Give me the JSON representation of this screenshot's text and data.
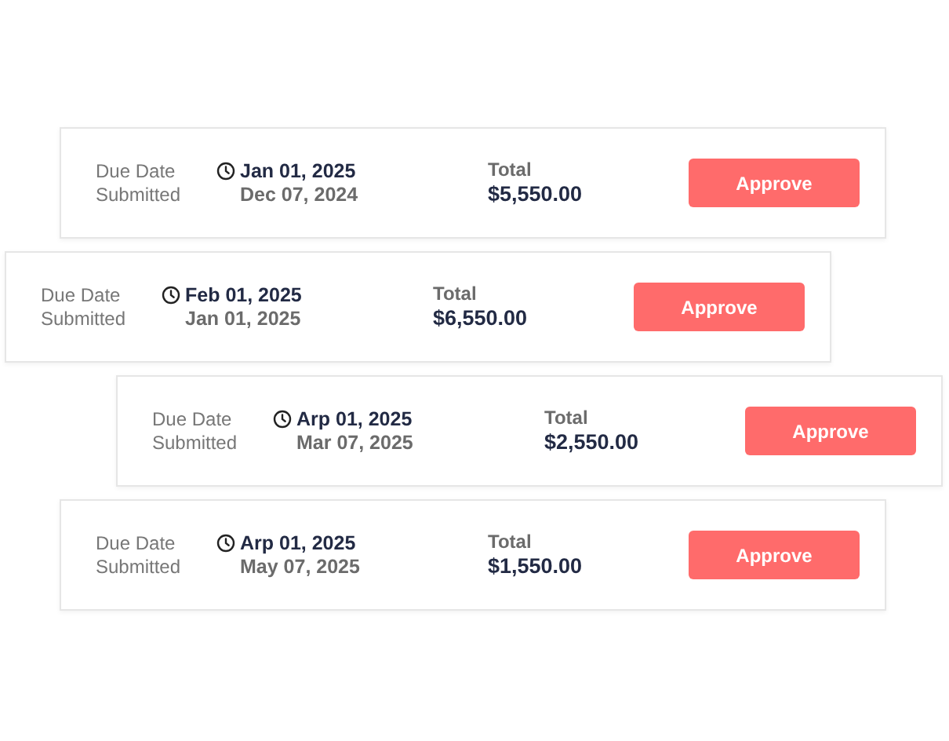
{
  "invoices": [
    {
      "due_label": "Due Date",
      "submitted_label": "Submitted",
      "due_date": "Jan 01, 2025",
      "submitted_date": "Dec 07, 2024",
      "total_label": "Total",
      "total": "$5,550.00",
      "button": "Approve"
    },
    {
      "due_label": "Due Date",
      "submitted_label": "Submitted",
      "due_date": "Feb 01, 2025",
      "submitted_date": "Jan 01, 2025",
      "total_label": "Total",
      "total": "$6,550.00",
      "button": "Approve"
    },
    {
      "due_label": "Due Date",
      "submitted_label": "Submitted",
      "due_date": "Arp 01, 2025",
      "submitted_date": "Mar 07, 2025",
      "total_label": "Total",
      "total": "$2,550.00",
      "button": "Approve"
    },
    {
      "due_label": "Due Date",
      "submitted_label": "Submitted",
      "due_date": "Arp 01, 2025",
      "submitted_date": "May 07, 2025",
      "total_label": "Total",
      "total": "$1,550.00",
      "button": "Approve"
    }
  ]
}
